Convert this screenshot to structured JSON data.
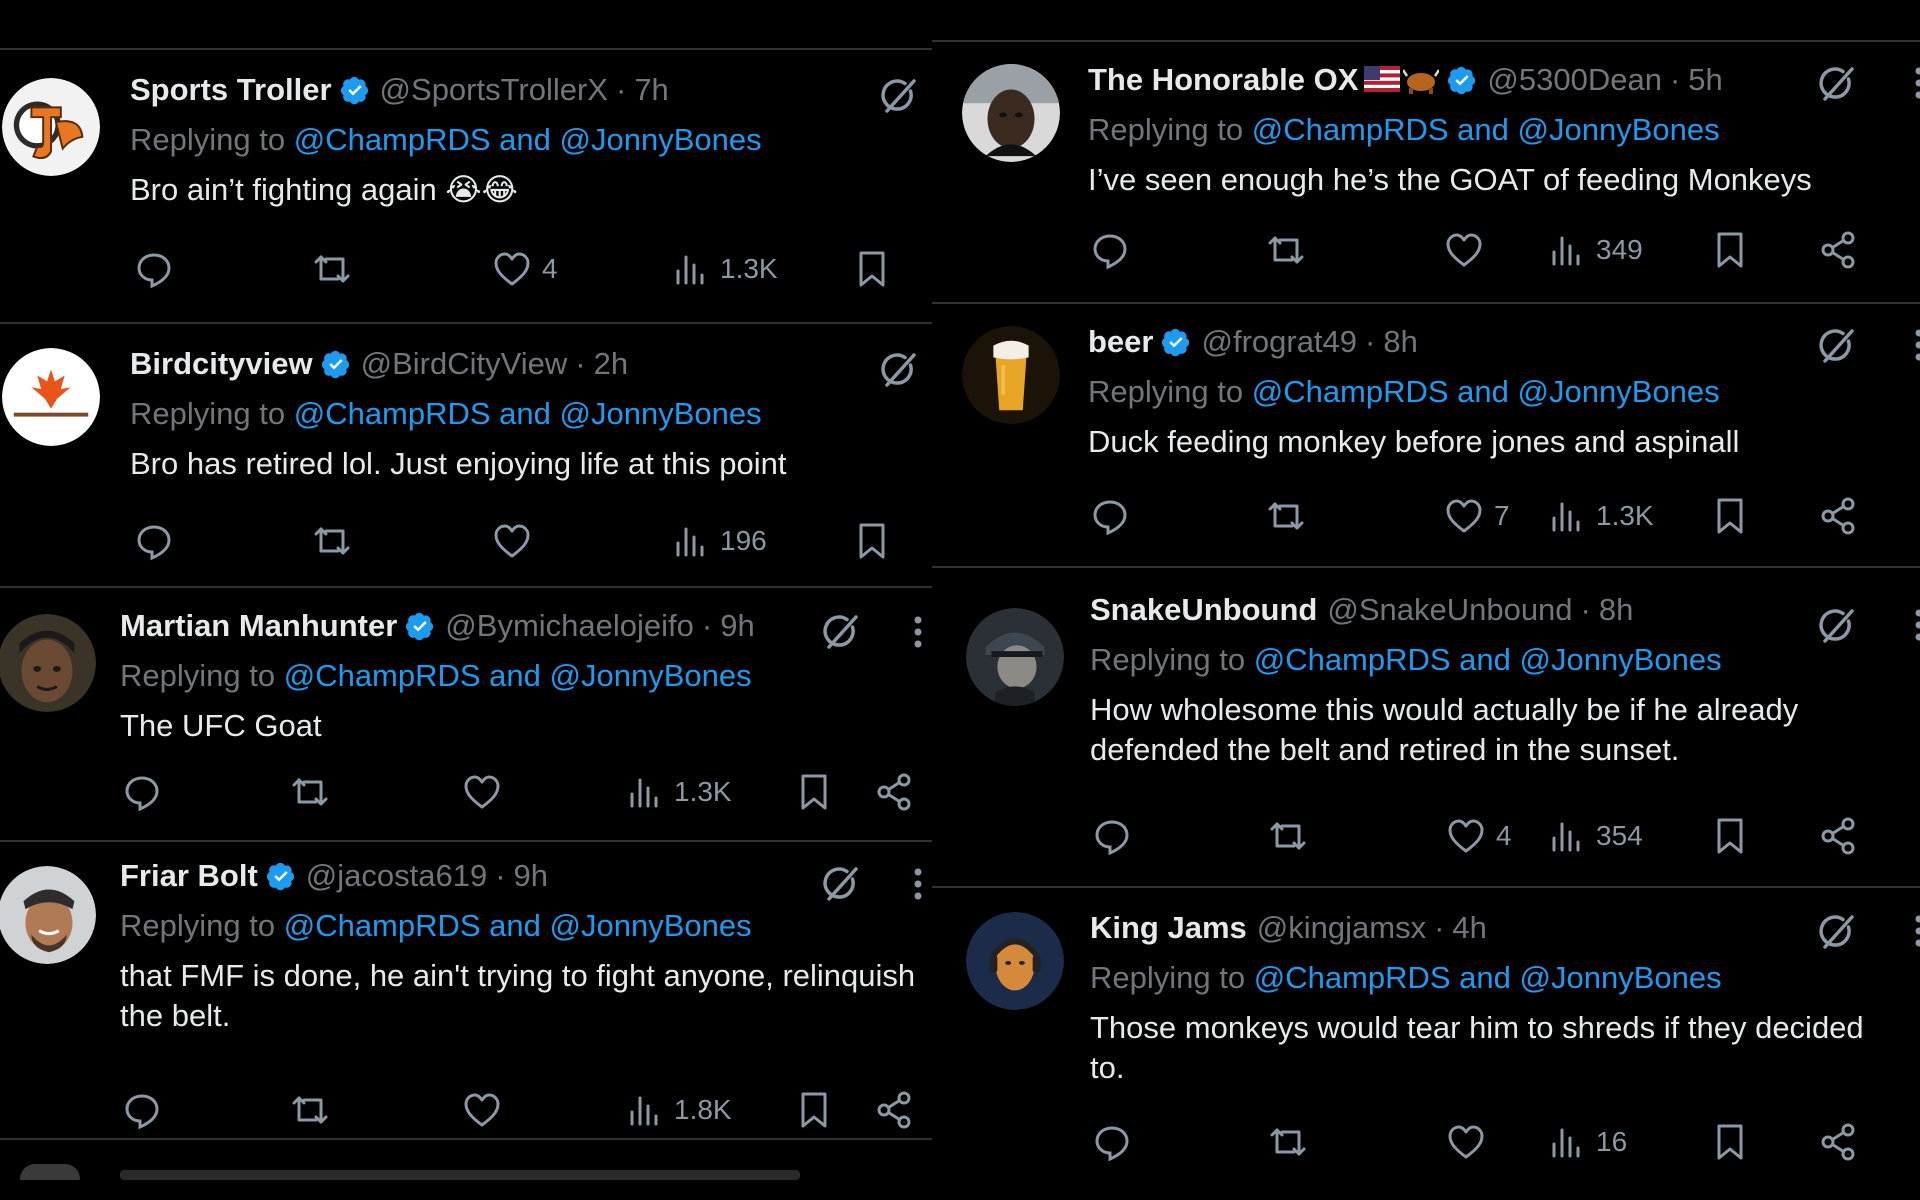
{
  "reply_prefix": "Replying to",
  "icons": {
    "reply": "reply-icon",
    "repost": "repost-icon",
    "like": "heart-icon",
    "views": "views-chart-icon",
    "bookmark": "bookmark-icon",
    "share": "share-icon",
    "grok": "grok-icon",
    "more": "more-icon",
    "verified": "verified-badge-icon"
  },
  "colors": {
    "background": "#000000",
    "text": "#e7e9ea",
    "muted": "#71767b",
    "link": "#1d9bf0",
    "verified": "#1d9bf0",
    "divider": "#2f3336"
  },
  "left_tweets": [
    {
      "name": "Sports Troller",
      "verified": true,
      "handle": "@SportsTrollerX",
      "time": "7h",
      "mentions": "@ChampRDS and @JonnyBones",
      "text": "Bro ain’t fighting again 😭😂",
      "likes": "4",
      "views": "1.3K",
      "show_more": false,
      "show_share": false
    },
    {
      "name": "Birdcityview",
      "verified": true,
      "handle": "@BirdCityView",
      "time": "2h",
      "mentions": "@ChampRDS and @JonnyBones",
      "text": "Bro has retired lol. Just enjoying life at this point",
      "likes": "",
      "views": "196",
      "show_more": false,
      "show_share": false
    },
    {
      "name": "Martian Manhunter",
      "verified": true,
      "handle": "@Bymichaelojeifo",
      "time": "9h",
      "mentions": "@ChampRDS and @JonnyBones",
      "text": "The UFC Goat",
      "likes": "",
      "views": "1.3K",
      "show_more": true,
      "show_share": true
    },
    {
      "name": "Friar Bolt",
      "verified": true,
      "handle": "@jacosta619",
      "time": "9h",
      "mentions": "@ChampRDS and @JonnyBones",
      "text": "that FMF is done, he ain't trying to fight anyone, relinquish the belt.",
      "likes": "",
      "views": "1.8K",
      "show_more": true,
      "show_share": true
    }
  ],
  "right_tweets": [
    {
      "name": "The Honorable OX",
      "name_emoji": "flag-and-ox",
      "verified": true,
      "handle": "@5300Dean",
      "time": "5h",
      "mentions": "@ChampRDS and @JonnyBones",
      "text": "I’ve seen enough he’s the GOAT of feeding Monkeys",
      "likes": "",
      "views": "349"
    },
    {
      "name": "beer",
      "verified": true,
      "handle": "@frograt49",
      "time": "8h",
      "mentions": "@ChampRDS and @JonnyBones",
      "text": "Duck feeding monkey before jones and aspinall",
      "likes": "7",
      "views": "1.3K"
    },
    {
      "name": "SnakeUnbound",
      "verified": false,
      "handle": "@SnakeUnbound",
      "time": "8h",
      "mentions": "@ChampRDS and @JonnyBones",
      "text": "How wholesome this would actually be if he already defended the belt and retired in the sunset.",
      "likes": "4",
      "views": "354"
    },
    {
      "name": "King Jams",
      "verified": false,
      "handle": "@kingjamsx",
      "time": "4h",
      "mentions": "@ChampRDS and @JonnyBones",
      "text": "Those monkeys would tear him to shreds if they decided to.",
      "likes": "",
      "views": "16"
    }
  ]
}
